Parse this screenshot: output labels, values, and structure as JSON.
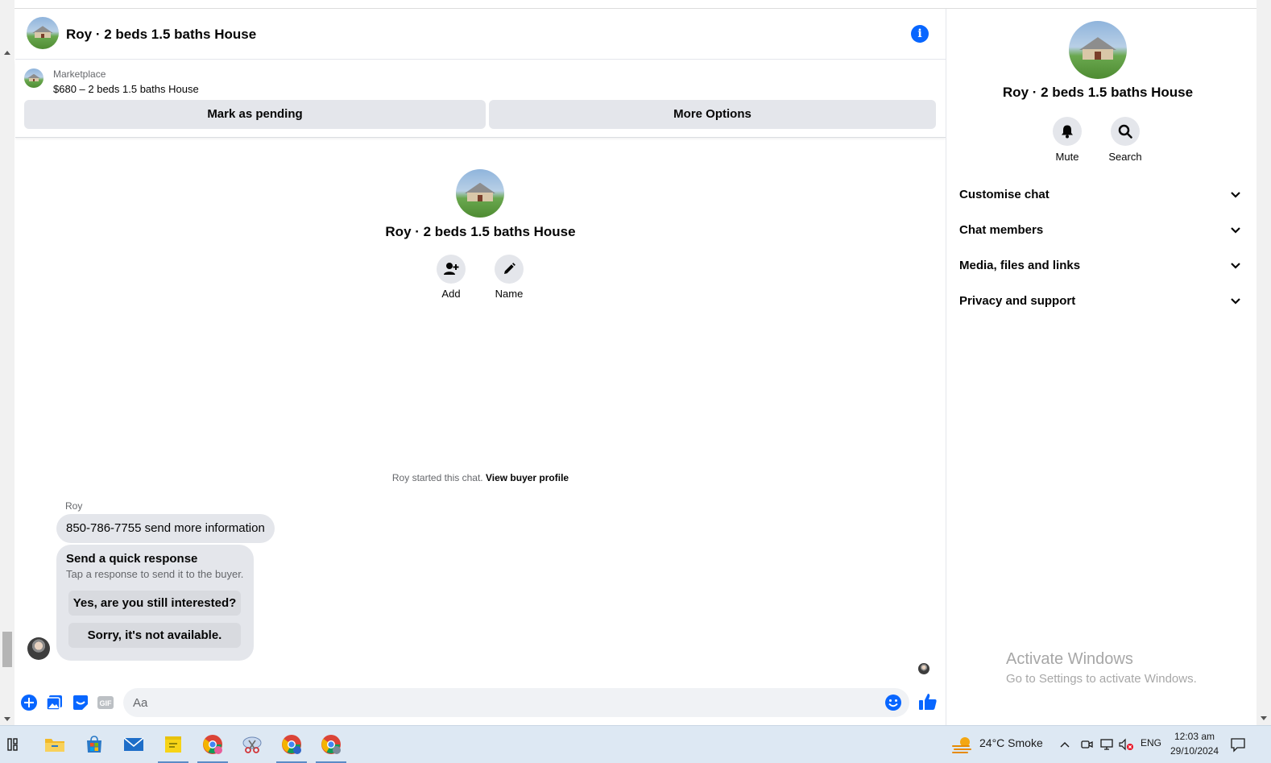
{
  "colors": {
    "accent": "#0866ff",
    "bubble": "#e4e6eb",
    "muted": "#65676b",
    "taskbar": "#dde8f3"
  },
  "header": {
    "title": "Roy · 2 beds 1.5 baths House",
    "info_icon": "info-icon"
  },
  "marketplace": {
    "label": "Marketplace",
    "item": "$680 – 2 beds 1.5 baths House",
    "mark_pending": "Mark as pending",
    "more_options": "More Options"
  },
  "intro": {
    "name": "Roy · 2 beds 1.5 baths House",
    "add_label": "Add",
    "name_label": "Name"
  },
  "started": {
    "text": "Roy started this chat.",
    "link": "View buyer profile"
  },
  "messages": {
    "sender": "Roy",
    "text": "850-786-7755 send more information"
  },
  "quick_response": {
    "title": "Send a quick response",
    "subtitle": "Tap a response to send it to the buyer.",
    "options": [
      "Yes, are you still interested?",
      "Sorry, it's not available."
    ]
  },
  "composer": {
    "placeholder": "Aa"
  },
  "right_panel": {
    "name": "Roy · 2 beds 1.5 baths House",
    "mute_label": "Mute",
    "search_label": "Search",
    "sections": [
      "Customise chat",
      "Chat members",
      "Media, files and links",
      "Privacy and support"
    ]
  },
  "watermark": {
    "line1": "Activate Windows",
    "line2": "Go to Settings to activate Windows."
  },
  "taskbar": {
    "weather": "24°C  Smoke",
    "lang": "ENG",
    "time": "12:03 am",
    "date": "29/10/2024"
  }
}
